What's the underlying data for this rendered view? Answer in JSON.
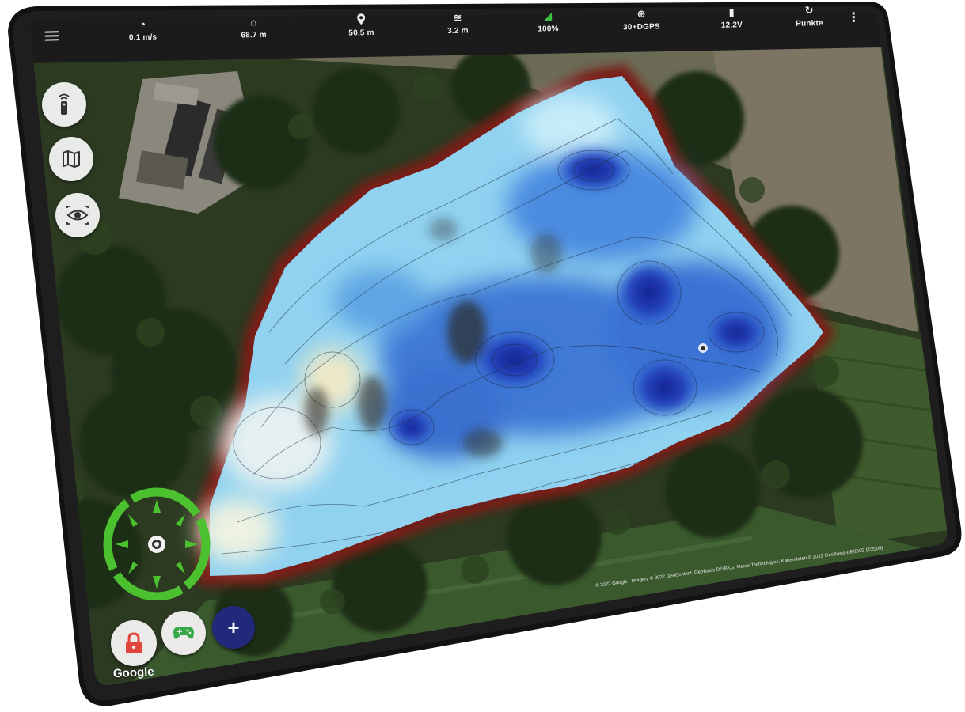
{
  "status_bar": {
    "items": [
      {
        "icon": "speedometer-icon",
        "glyph": "◔",
        "value": "0.1 m/s"
      },
      {
        "icon": "home-icon",
        "glyph": "⌂",
        "value": "68.7 m"
      },
      {
        "icon": "location-pin-icon",
        "glyph": "⬤",
        "value": "50.5 m"
      },
      {
        "icon": "sonar-depth-icon",
        "glyph": "≋",
        "value": "3.2 m"
      },
      {
        "icon": "signal-strength-icon",
        "glyph": "◢",
        "value": "100%"
      },
      {
        "icon": "gps-fix-icon",
        "glyph": "⊕",
        "value": "30+DGPS"
      },
      {
        "icon": "battery-icon",
        "glyph": "▮",
        "value": "12.2V"
      },
      {
        "icon": "refresh-points-icon",
        "glyph": "↻",
        "value": "Punkte"
      }
    ]
  },
  "left_tools": [
    {
      "name": "remote-control-icon"
    },
    {
      "name": "map-layers-icon"
    },
    {
      "name": "view-eye-icon"
    }
  ],
  "bottom_buttons": {
    "lock": {
      "icon": "lock-icon",
      "color": "#e0463c"
    },
    "gamepad": {
      "icon": "gamepad-icon",
      "color": "#36a84a"
    },
    "add": {
      "label": "+",
      "color": "#23297a"
    }
  },
  "compass": {
    "color": "#4cc12f"
  },
  "map": {
    "google_logo": "Google",
    "attribution": "© 2022 Google · Imagery © 2022 GeoContent, GeoBasis-DE/BKG, Maxar Technologies, Kartendaten © 2022 GeoBasis-DE/BKG (©2009)"
  },
  "colors": {
    "deep": "#1a2fa8",
    "mid": "#3f7fd8",
    "shallow": "#8fd4f2",
    "very_shallow": "#e9f2f4",
    "shore": "#8a1c14",
    "bezel": "#151515",
    "topbar": "#1a1a1a"
  }
}
